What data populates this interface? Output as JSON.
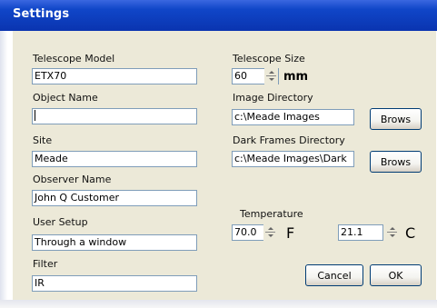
{
  "window": {
    "title": "Settings"
  },
  "left": {
    "telescope_model": {
      "label": "Telescope Model",
      "value": "ETX70"
    },
    "object_name": {
      "label": "Object Name",
      "value": ""
    },
    "site": {
      "label": "Site",
      "value": "Meade"
    },
    "observer_name": {
      "label": "Observer Name",
      "value": "John Q Customer"
    },
    "user_setup": {
      "label": "User Setup",
      "value": "Through a window"
    },
    "filter": {
      "label": "Filter",
      "value": "IR"
    }
  },
  "right": {
    "telescope_size": {
      "label": "Telescope Size",
      "value": "60",
      "unit": "mm"
    },
    "image_directory": {
      "label": "Image Directory",
      "value": "c:\\Meade Images",
      "button": "Brows"
    },
    "dark_frames_directory": {
      "label": "Dark Frames Directory",
      "value": "c:\\Meade Images\\Dark",
      "button": "Brows"
    },
    "temperature": {
      "label": "Temperature",
      "fahrenheit": "70.0",
      "f_unit": "F",
      "celsius": "21.1",
      "c_unit": "C"
    }
  },
  "buttons": {
    "cancel": "Cancel",
    "ok": "OK"
  }
}
